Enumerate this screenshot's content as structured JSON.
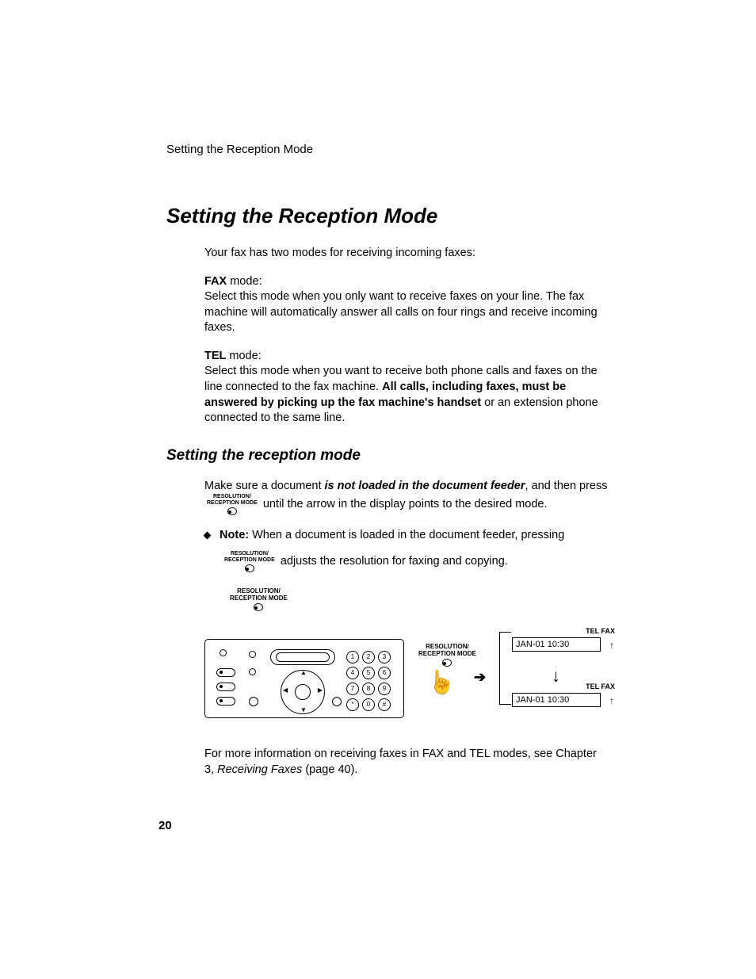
{
  "header": {
    "running": "Setting the Reception Mode"
  },
  "title": "Setting the Reception Mode",
  "intro": "Your fax has two modes for receiving incoming faxes:",
  "fax_mode": {
    "label": "FAX",
    "suffix": " mode:",
    "body": "Select this mode when you only want to receive faxes on your line. The fax machine will automatically answer all calls on four rings and receive incoming faxes."
  },
  "tel_mode": {
    "label": "TEL",
    "suffix": " mode:",
    "body_pre": "Select this mode when you want to receive both phone calls and faxes on the line connected to the fax machine. ",
    "body_bold": "All calls, including faxes, must be answered by picking up the fax machine's handset",
    "body_post": " or an extension phone connected to the same line."
  },
  "subhead": "Setting the reception mode",
  "step": {
    "pre": "Make sure a document ",
    "emph": "is not loaded in the document feeder",
    "mid": ", and then press ",
    "post": " until the arrow in the display points to the desired mode."
  },
  "note": {
    "label": "Note:",
    "line1": " When a document is loaded in the document feeder, pressing",
    "line2": " adjusts the resolution for faxing and copying."
  },
  "button_label": {
    "l1": "RESOLUTION/",
    "l2": "RECEPTION MODE"
  },
  "keypad": [
    "1",
    "2",
    "3",
    "4",
    "5",
    "6",
    "7",
    "8",
    "9",
    "*",
    "0",
    "#"
  ],
  "display": {
    "head": "TEL   FAX",
    "text": "JAN-01 10:30"
  },
  "footer": {
    "pre": "For more information on receiving faxes in FAX and TEL modes, see Chapter 3, ",
    "ref": "Receiving Faxes",
    "post": " (page 40)."
  },
  "page_number": "20"
}
